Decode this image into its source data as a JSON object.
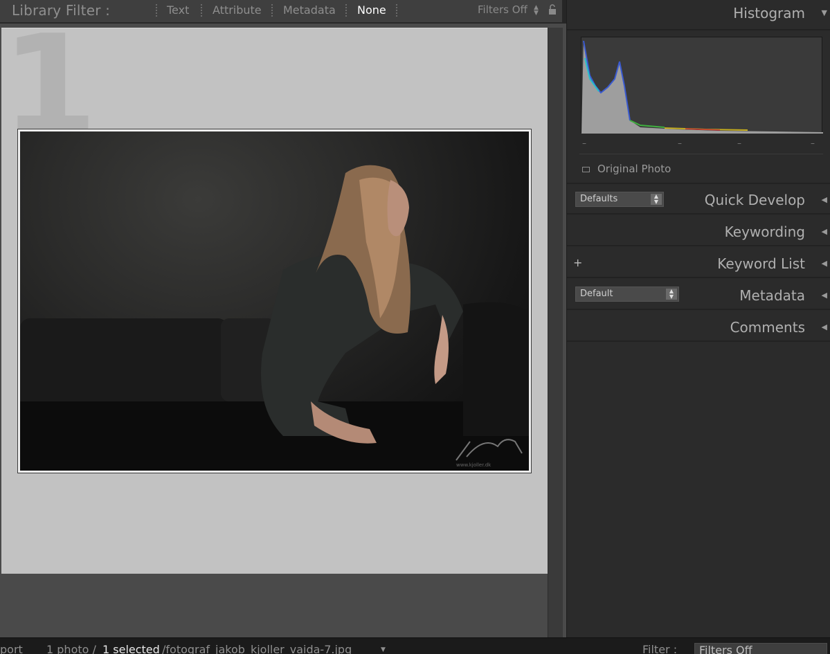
{
  "filter_bar": {
    "title": "Library Filter :",
    "options": [
      "Text",
      "Attribute",
      "Metadata",
      "None"
    ],
    "active": "None",
    "filters_status": "Filters Off"
  },
  "grid": {
    "cell_number": "1"
  },
  "photo_watermark": "www.kjoller.dk",
  "right_panel": {
    "histogram": {
      "label": "Histogram",
      "ticks": [
        "–",
        "–",
        "–",
        "–"
      ],
      "original_photo_label": "Original Photo"
    },
    "quick_develop": {
      "label": "Quick Develop",
      "preset": "Defaults"
    },
    "keywording": {
      "label": "Keywording"
    },
    "keyword_list": {
      "label": "Keyword List",
      "add": "+"
    },
    "metadata": {
      "label": "Metadata",
      "preset": "Default"
    },
    "comments": {
      "label": "Comments"
    }
  },
  "bottom_bar": {
    "left_fragment": "port",
    "count": "1 photo /",
    "selected": "1 selected",
    "filename": "/fotograf_jakob_kjoller_vaida-7.jpg",
    "filter_label": "Filter :",
    "filter_value": "Filters Off"
  }
}
